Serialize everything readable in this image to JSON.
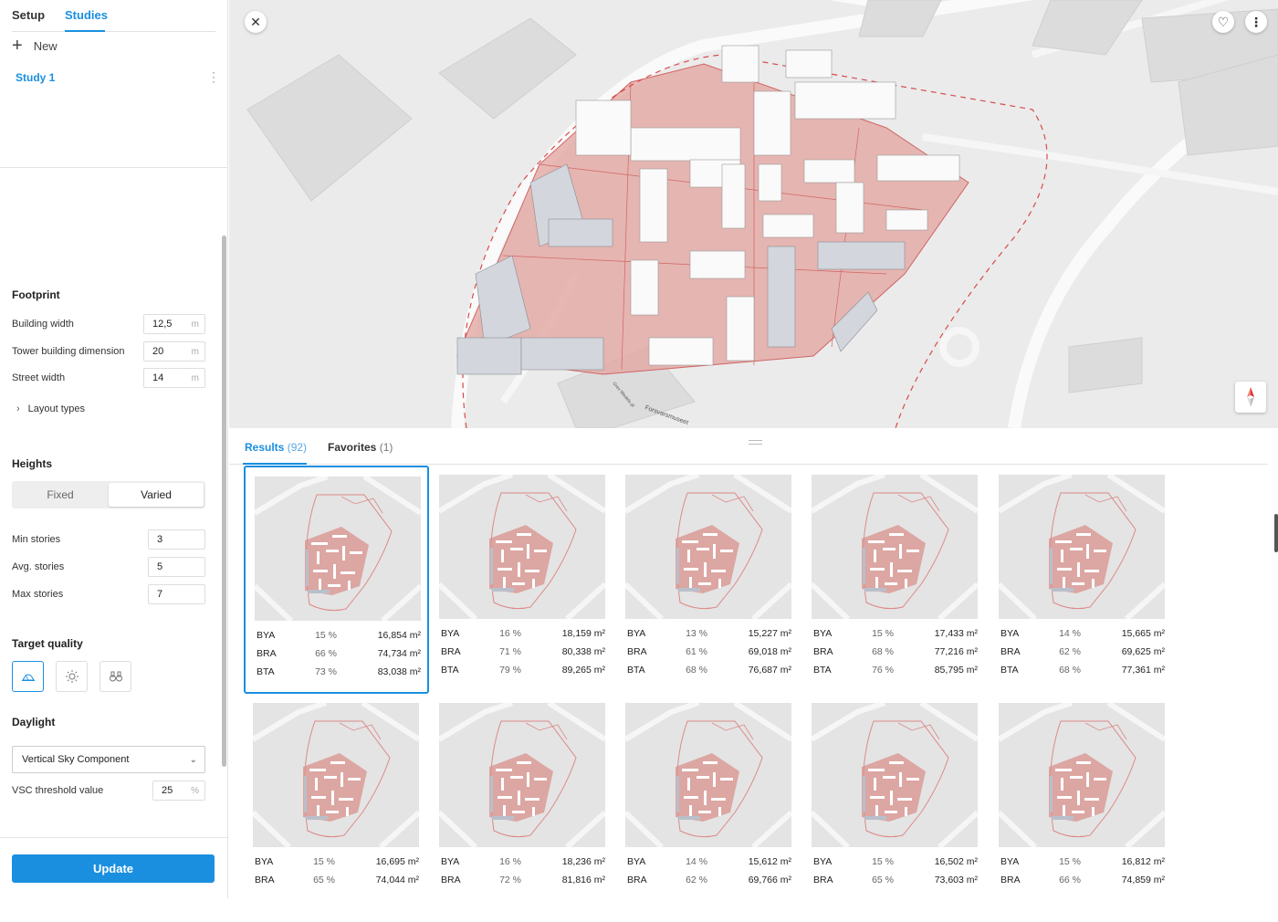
{
  "sidebar": {
    "tabs": {
      "setup": "Setup",
      "studies": "Studies"
    },
    "new_label": "New",
    "study_name": "Study 1",
    "footprint": {
      "title": "Footprint",
      "building_width": {
        "label": "Building width",
        "value": "12,5",
        "unit": "m"
      },
      "tower_dimension": {
        "label": "Tower building dimension",
        "value": "20",
        "unit": "m"
      },
      "street_width": {
        "label": "Street width",
        "value": "14",
        "unit": "m"
      },
      "layout_types": "Layout types"
    },
    "heights": {
      "title": "Heights",
      "fixed": "Fixed",
      "varied": "Varied",
      "min_stories": {
        "label": "Min stories",
        "value": "3"
      },
      "avg_stories": {
        "label": "Avg. stories",
        "value": "5"
      },
      "max_stories": {
        "label": "Max stories",
        "value": "7"
      }
    },
    "target_quality": {
      "title": "Target quality",
      "icons": [
        "daylight-dome-icon",
        "sun-icon",
        "binoculars-icon"
      ]
    },
    "daylight": {
      "title": "Daylight",
      "method": "Vertical Sky Component",
      "threshold": {
        "label": "VSC threshold value",
        "value": "25",
        "unit": "%"
      }
    },
    "update_label": "Update"
  },
  "map": {
    "labels": {
      "street": "Forsvarsmuseet",
      "street2": "Grev Wedels pl"
    }
  },
  "results": {
    "tabs": {
      "results": "Results",
      "results_count": "(92)",
      "favorites": "Favorites",
      "favorites_count": "(1)"
    },
    "cards": [
      {
        "bya": "15 %",
        "bya_area": "16,854 m²",
        "bra": "66 %",
        "bra_area": "74,734 m²",
        "bta": "73 %",
        "bta_area": "83,038 m²"
      },
      {
        "bya": "16 %",
        "bya_area": "18,159 m²",
        "bra": "71 %",
        "bra_area": "80,338 m²",
        "bta": "79 %",
        "bta_area": "89,265 m²"
      },
      {
        "bya": "13 %",
        "bya_area": "15,227 m²",
        "bra": "61 %",
        "bra_area": "69,018 m²",
        "bta": "68 %",
        "bta_area": "76,687 m²"
      },
      {
        "bya": "15 %",
        "bya_area": "17,433 m²",
        "bra": "68 %",
        "bra_area": "77,216 m²",
        "bta": "76 %",
        "bta_area": "85,795 m²"
      },
      {
        "bya": "14 %",
        "bya_area": "15,665 m²",
        "bra": "62 %",
        "bra_area": "69,625 m²",
        "bta": "68 %",
        "bta_area": "77,361 m²"
      },
      {
        "bya": "15 %",
        "bya_area": "16,695 m²",
        "bra": "65 %",
        "bra_area": "74,044 m²"
      },
      {
        "bya": "16 %",
        "bya_area": "18,236 m²",
        "bra": "72 %",
        "bra_area": "81,816 m²"
      },
      {
        "bya": "14 %",
        "bya_area": "15,612 m²",
        "bra": "62 %",
        "bra_area": "69,766 m²"
      },
      {
        "bya": "15 %",
        "bya_area": "16,502 m²",
        "bra": "65 %",
        "bra_area": "73,603 m²"
      },
      {
        "bya": "15 %",
        "bya_area": "16,812 m²",
        "bra": "66 %",
        "bra_area": "74,859 m²"
      }
    ],
    "metric_labels": {
      "bya": "BYA",
      "bra": "BRA",
      "bta": "BTA"
    }
  },
  "colors": {
    "accent": "#1a8fe0",
    "site_fill": "#e3a8a3",
    "building": "#f7f7f7"
  }
}
